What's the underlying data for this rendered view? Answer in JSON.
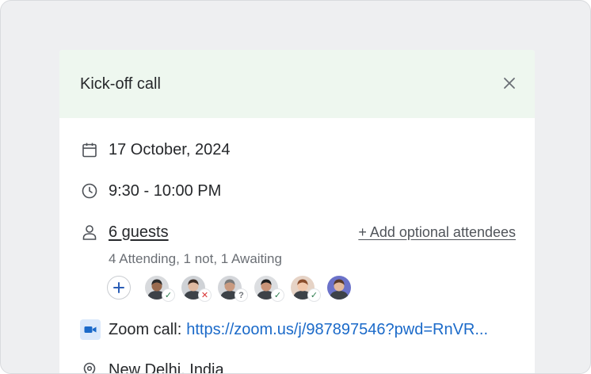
{
  "event": {
    "title": "Kick-off call",
    "date": "17 October, 2024",
    "time": "9:30 - 10:00 PM",
    "guests_label": "6 guests",
    "add_optional_label": "+ Add optional attendees",
    "guest_summary": "4 Attending, 1 not, 1 Awaiting",
    "zoom_prefix": "Zoom call:",
    "zoom_link": "https://zoom.us/j/987897546?pwd=RnVR...",
    "location_partial": "New Delhi, India"
  },
  "avatars": [
    {
      "status": "attending",
      "status_glyph": "✓",
      "skin": "#9a6b4f",
      "hair": "#2b2b2b",
      "bg": "#d8dadd"
    },
    {
      "status": "declined",
      "status_glyph": "✕",
      "skin": "#e0b9a0",
      "hair": "#3a2a22",
      "bg": "#cfd2d6"
    },
    {
      "status": "awaiting",
      "status_glyph": "?",
      "skin": "#c99a80",
      "hair": "#7a7a7a",
      "bg": "#d4d6da"
    },
    {
      "status": "attending",
      "status_glyph": "✓",
      "skin": "#c99478",
      "hair": "#1f1f1f",
      "bg": "#dcdee1"
    },
    {
      "status": "attending",
      "status_glyph": "✓",
      "skin": "#f1c7ab",
      "hair": "#8a4d2c",
      "bg": "#e6d3c6"
    },
    {
      "status": "none",
      "status_glyph": "",
      "skin": "#e3b99c",
      "hair": "#5a3a28",
      "bg": "#6b72c9"
    }
  ],
  "colors": {
    "accent_link": "#1b6ac9",
    "header_bg": "#eef7ef",
    "attending": "#2e7d4f",
    "declined": "#d93636"
  },
  "icons": [
    "close-icon",
    "calendar-icon",
    "clock-icon",
    "person-icon",
    "plus-icon",
    "video-camera-icon",
    "location-pin-icon"
  ]
}
